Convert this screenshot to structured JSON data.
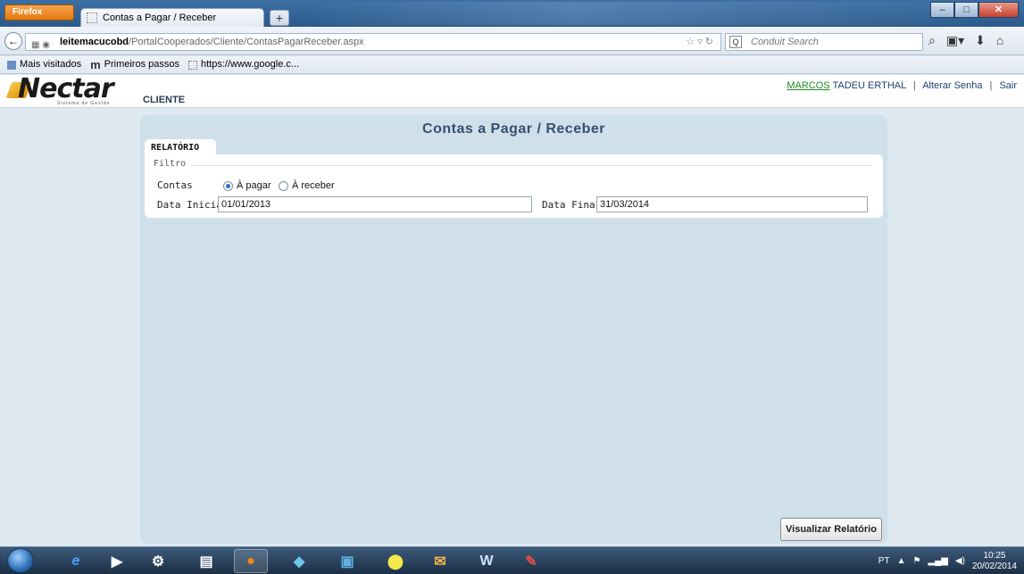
{
  "browser": {
    "app_button": "Firefox",
    "tab_title": "Contas a Pagar / Receber",
    "new_tab": "+",
    "url_host": "leitemacucobd",
    "url_path": "/PortalCooperados/Cliente/ContasPagarReceber.aspx",
    "search_placeholder": "Conduit Search",
    "bookmarks": [
      "Mais visitados",
      "Primeiros passos",
      "https://www.google.c..."
    ]
  },
  "header": {
    "logo_text": "Nectar",
    "logo_tagline": "Sistema de Gestão",
    "section": "CLIENTE",
    "user_first": "MARCOS",
    "user_rest": "TADEU ERTHAL",
    "change_password": "Alterar Senha",
    "logout": "Sair"
  },
  "main": {
    "title": "Contas a Pagar / Receber",
    "tab_label": "RELATÓRIO",
    "filter_legend": "Filtro",
    "contas_label": "Contas",
    "radio_pagar": "À pagar",
    "radio_receber": "À receber",
    "selected": "pagar",
    "data_inicial_label": "Data Inicial",
    "data_inicial_value": "01/01/2013",
    "data_final_label": "Data Final",
    "data_final_value": "31/03/2014",
    "view_button": "Visualizar Relatório"
  },
  "taskbar": {
    "lang": "PT",
    "time": "10:25",
    "date": "20/02/2014"
  },
  "colors": {
    "panel": "#cfe0ea",
    "title": "#35506e",
    "user_link": "#1f8b24"
  }
}
